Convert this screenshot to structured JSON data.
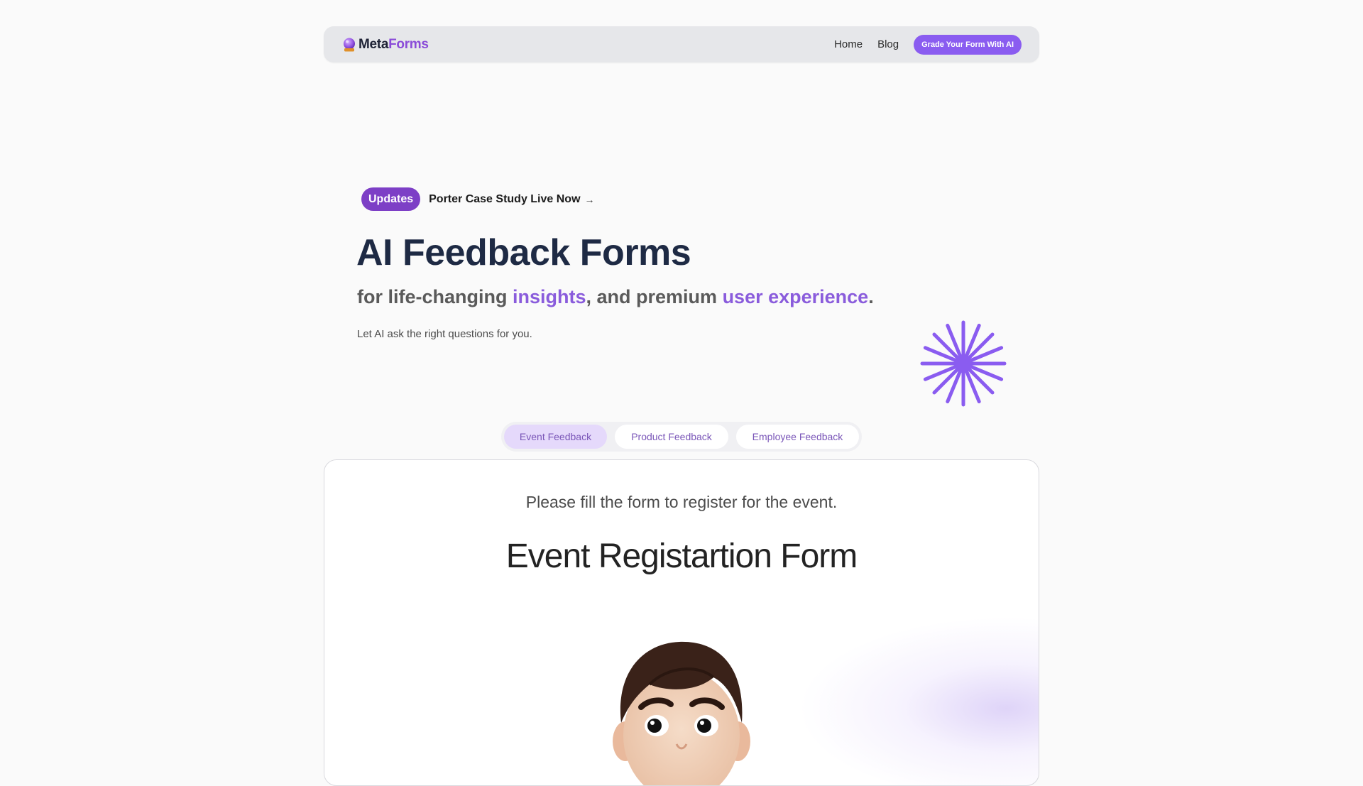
{
  "nav": {
    "brand_meta": "Meta",
    "brand_forms": "Forms",
    "links": [
      "Home",
      "Blog"
    ],
    "cta": "Grade Your Form With AI"
  },
  "hero": {
    "badge": "Updates",
    "update_link": "Porter Case Study Live Now",
    "title": "AI Feedback Forms",
    "sub_part1": "for life-changing ",
    "sub_hl1": "insights",
    "sub_part2": ", and premium ",
    "sub_hl2": "user experience",
    "sub_part3": ".",
    "desc": "Let AI ask the right questions for you."
  },
  "tabs": [
    {
      "label": "Event Feedback",
      "active": true
    },
    {
      "label": "Product Feedback",
      "active": false
    },
    {
      "label": "Employee Feedback",
      "active": false
    }
  ],
  "form": {
    "note": "Please fill the form to register for the event.",
    "title": "Event Registartion Form"
  },
  "colors": {
    "accent": "#8a5cf0",
    "badge": "#7d3fc6",
    "highlight": "#8a5cdc",
    "title": "#1e2a44"
  },
  "icons": {
    "brand": "crystal-ball-icon",
    "update_arrow": "arrow-right-icon",
    "decor": "starburst-icon"
  }
}
